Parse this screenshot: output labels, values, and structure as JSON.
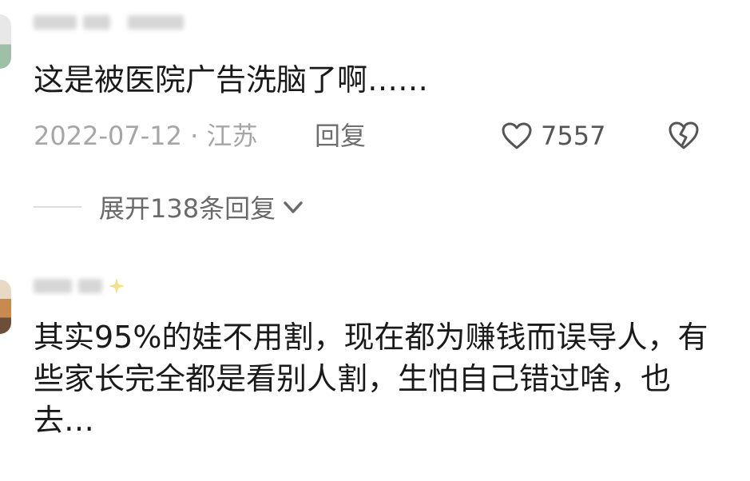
{
  "comments": [
    {
      "text": "这是被医院广告洗脑了啊……",
      "date_location": "2022-07-12 · 江苏",
      "reply_label": "回复",
      "like_count": "7557",
      "expand_label": "展开138条回复"
    },
    {
      "text": "其实95%的娃不用割，现在都为赚钱而误导人，有些家长完全都是看别人割，生怕自己错过啥，也去…"
    }
  ],
  "icons": {
    "like": "heart-outline-icon",
    "dislike": "broken-heart-icon",
    "expand": "chevron-down-icon"
  },
  "colors": {
    "text": "#1a1a1a",
    "meta": "#a6a6a6",
    "action": "#555555"
  }
}
